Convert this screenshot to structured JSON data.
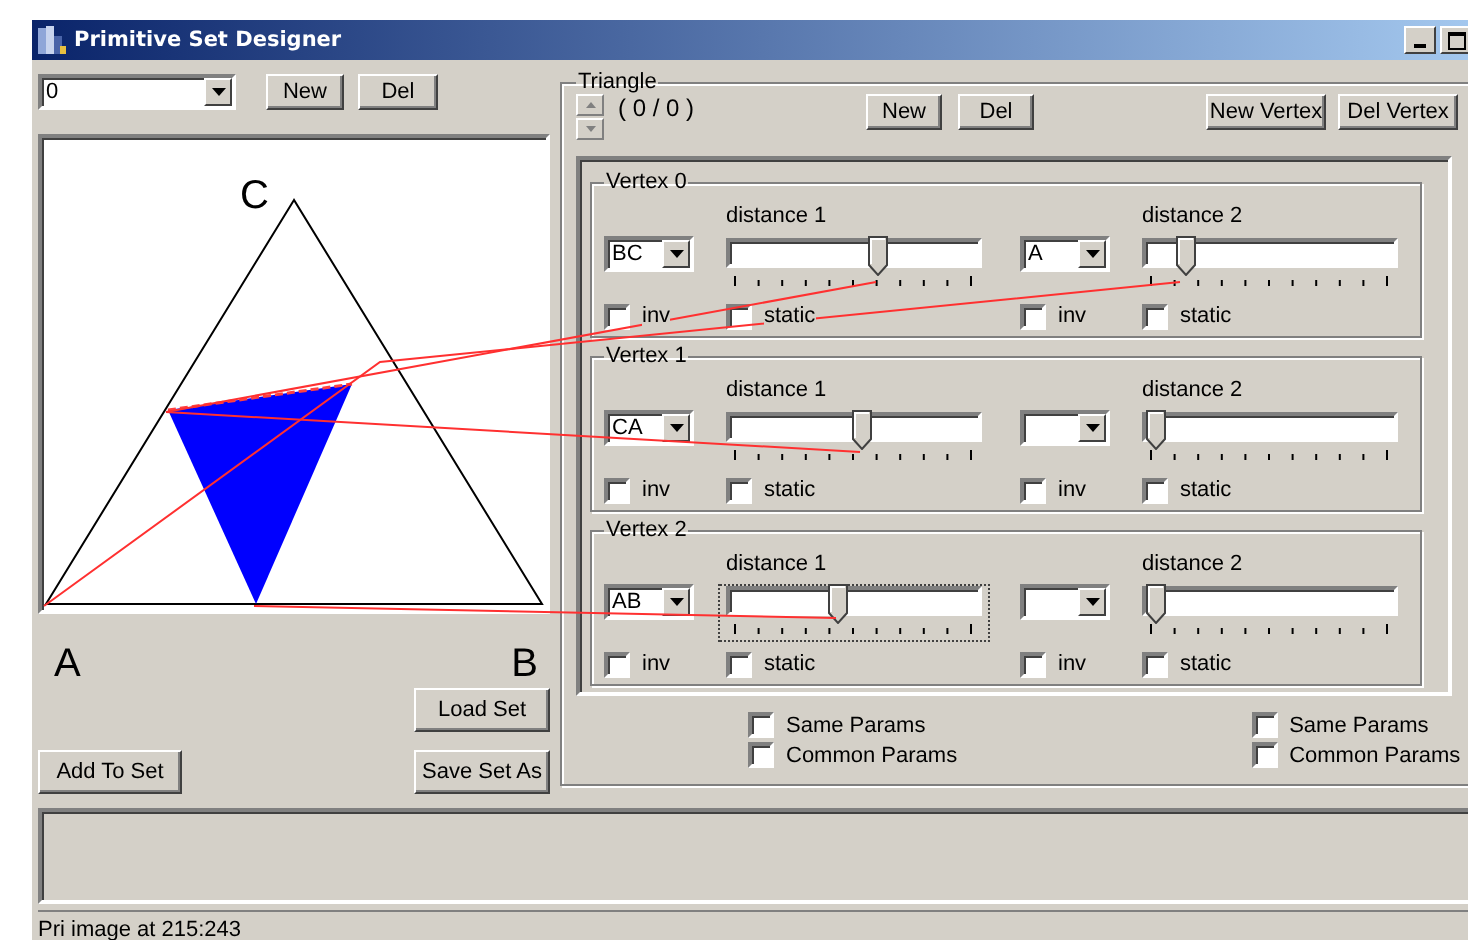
{
  "window": {
    "title": "Primitive Set Designer"
  },
  "set_selector": {
    "value": "0"
  },
  "set_buttons": [
    "New",
    "Del"
  ],
  "canvas": {
    "top_label": "C",
    "bottom_labels": [
      "A",
      "B"
    ]
  },
  "left_buttons": {
    "load": "Load Set",
    "add": "Add To Set",
    "save": "Save Set As"
  },
  "triangle": {
    "legend": "Triangle",
    "counter": "( 0 / 0 )",
    "buttons": [
      "New",
      "Del"
    ],
    "vertex_buttons": [
      "New Vertex",
      "Del Vertex"
    ],
    "vertices": [
      {
        "legend": "Vertex 0",
        "sides": [
          {
            "selector": "BC",
            "label": "distance 1",
            "level": 0.6,
            "focused": false,
            "checks": [
              {
                "label": "inv",
                "checked": false
              },
              {
                "label": "static",
                "checked": false
              }
            ]
          },
          {
            "selector": "A",
            "label": "distance 2",
            "level": 0.13,
            "focused": false,
            "checks": [
              {
                "label": "inv",
                "checked": false
              },
              {
                "label": "static",
                "checked": false
              }
            ]
          }
        ]
      },
      {
        "legend": "Vertex 1",
        "sides": [
          {
            "selector": "CA",
            "label": "distance 1",
            "level": 0.53,
            "focused": false,
            "checks": [
              {
                "label": "inv",
                "checked": false
              },
              {
                "label": "static",
                "checked": false
              }
            ]
          },
          {
            "label": "distance 2",
            "level": 0,
            "focused": false,
            "checks": [
              {
                "label": "inv",
                "checked": false
              },
              {
                "label": "static",
                "checked": false
              }
            ]
          }
        ]
      },
      {
        "legend": "Vertex 2",
        "sides": [
          {
            "selector": "AB",
            "label": "distance 1",
            "level": 0.43,
            "focused": true,
            "checks": [
              {
                "label": "inv",
                "checked": false
              },
              {
                "label": "static",
                "checked": false
              }
            ]
          },
          {
            "label": "distance 2",
            "level": 0,
            "focused": false,
            "checks": [
              {
                "label": "inv",
                "checked": false
              },
              {
                "label": "static",
                "checked": false
              }
            ]
          }
        ]
      }
    ]
  },
  "params": [
    [
      {
        "label": "Same Params",
        "checked": false
      },
      {
        "label": "Common Params",
        "checked": false
      }
    ],
    [
      {
        "label": "Same Params",
        "checked": false
      },
      {
        "label": "Common Params",
        "checked": false
      }
    ]
  ],
  "status_bar": {
    "text": "Pri image at 215:243"
  }
}
